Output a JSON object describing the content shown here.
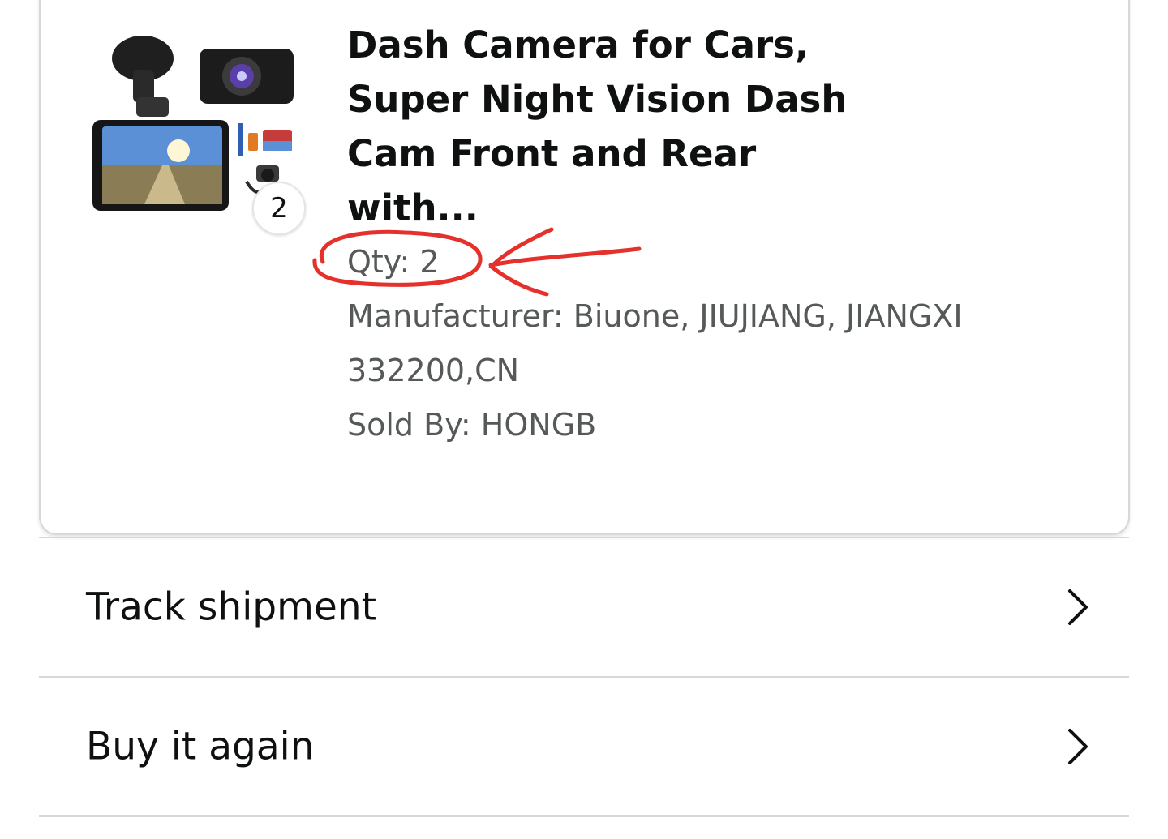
{
  "product": {
    "title": "Dash Camera for Cars, Super Night Vision Dash Cam Front and Rear with...",
    "thumbnail_icon": "dash-camera-product-image",
    "badge_quantity": "2",
    "quantity": "Qty: 2",
    "manufacturer": "Manufacturer: Biuone, JIUJIANG, JIANGXI 332200,CN",
    "sold_by": "Sold By: HONGB"
  },
  "annotation": {
    "color": "#e4312b",
    "target": "quantity",
    "shape": "hand-drawn circle with arrow"
  },
  "actions": [
    {
      "label": "Track shipment",
      "icon": "chevron-right-icon"
    },
    {
      "label": "Buy it again",
      "icon": "chevron-right-icon"
    }
  ],
  "colors": {
    "text_primary": "#0f1111",
    "text_secondary": "#565959",
    "divider": "#d5d9d9"
  }
}
